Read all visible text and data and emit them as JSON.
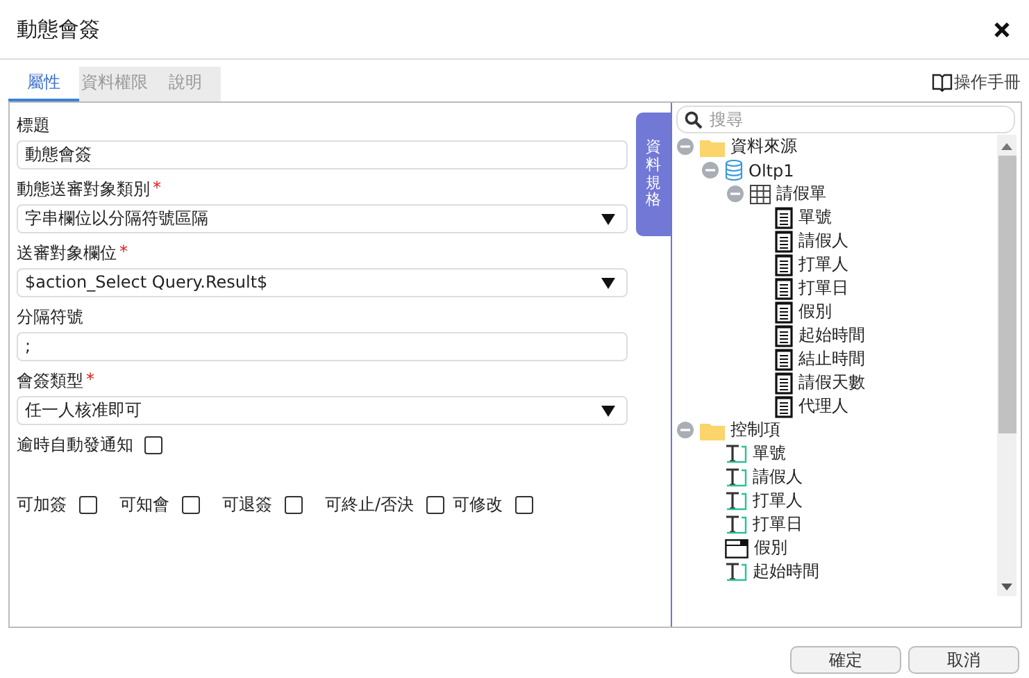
{
  "window": {
    "title": "動態會簽"
  },
  "manual_link": "操作手冊",
  "tabs": [
    {
      "label": "屬性",
      "selected": true
    },
    {
      "label": "資料權限",
      "selected": false
    },
    {
      "label": "說明",
      "selected": false
    }
  ],
  "fields": [
    {
      "label": "標題",
      "kind": "text",
      "value": "動態會簽"
    },
    {
      "label": "動態送審對象類別",
      "required_mark": "*",
      "kind": "select",
      "value": "字串欄位以分隔符號區隔"
    },
    {
      "label": "送審對象欄位",
      "required_mark": "*",
      "kind": "select",
      "value": "$action_Select Query.Result$"
    },
    {
      "label": "分隔符號",
      "kind": "text",
      "value": ";"
    },
    {
      "label": "會簽類型",
      "required_mark": "*",
      "kind": "select",
      "value": "任一人核准即可"
    }
  ],
  "notify": {
    "label": "逾時自動發通知",
    "checked": false
  },
  "options": [
    {
      "label": "可加簽",
      "checked": false
    },
    {
      "label": "可知會",
      "checked": false
    },
    {
      "label": "可退簽",
      "checked": false
    },
    {
      "label": "可終止/否決",
      "checked": false
    },
    {
      "label": "可修改",
      "checked": false
    }
  ],
  "side_tab": "資料規格",
  "search": {
    "placeholder": "搜尋"
  },
  "tree": [
    {
      "label": "資料來源",
      "kind": "folder",
      "expanded": true,
      "children": [
        {
          "label": "Oltp1",
          "kind": "database",
          "expanded": true,
          "children": [
            {
              "label": "請假單",
              "kind": "table",
              "expanded": true,
              "children": [
                {
                  "label": "單號",
                  "kind": "field"
                },
                {
                  "label": "請假人",
                  "kind": "field"
                },
                {
                  "label": "打單人",
                  "kind": "field"
                },
                {
                  "label": "打單日",
                  "kind": "field"
                },
                {
                  "label": "假別",
                  "kind": "field"
                },
                {
                  "label": "起始時間",
                  "kind": "field"
                },
                {
                  "label": "結止時間",
                  "kind": "field"
                },
                {
                  "label": "請假天數",
                  "kind": "field"
                },
                {
                  "label": "代理人",
                  "kind": "field"
                }
              ]
            }
          ]
        }
      ]
    },
    {
      "label": "控制項",
      "kind": "folder",
      "expanded": true,
      "children": [
        {
          "label": "單號",
          "kind": "text-control"
        },
        {
          "label": "請假人",
          "kind": "text-control"
        },
        {
          "label": "打單人",
          "kind": "text-control"
        },
        {
          "label": "打單日",
          "kind": "text-control"
        },
        {
          "label": "假別",
          "kind": "dropdown-control"
        },
        {
          "label": "起始時間",
          "kind": "text-control"
        }
      ]
    }
  ],
  "buttons": [
    "確定",
    "取消"
  ]
}
